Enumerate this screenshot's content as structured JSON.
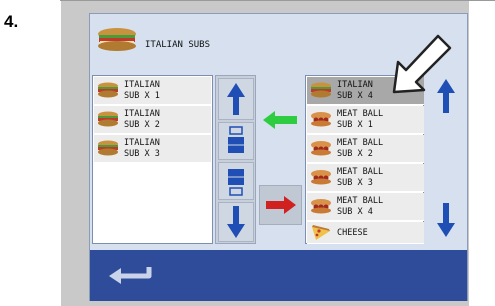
{
  "step": {
    "number": "4."
  },
  "header": {
    "title": "ITALIAN SUBS",
    "icon": "sub-sandwich-icon"
  },
  "left_list": {
    "items": [
      {
        "label": "ITALIAN\nSUB X 1",
        "icon": "sub-sandwich-icon"
      },
      {
        "label": "ITALIAN\nSUB X 2",
        "icon": "sub-sandwich-icon"
      },
      {
        "label": "ITALIAN\nSUB X 3",
        "icon": "sub-sandwich-icon"
      }
    ]
  },
  "right_list": {
    "items": [
      {
        "label": "ITALIAN\nSUB X 4",
        "icon": "sub-sandwich-icon",
        "selected": true
      },
      {
        "label": "MEAT BALL\nSUB X 1",
        "icon": "meatball-sub-icon"
      },
      {
        "label": "MEAT BALL\nSUB X 2",
        "icon": "meatball-sub-icon"
      },
      {
        "label": "MEAT BALL\nSUB X 3",
        "icon": "meatball-sub-icon"
      },
      {
        "label": "MEAT BALL\nSUB X 4",
        "icon": "meatball-sub-icon"
      },
      {
        "label": "CHEESE",
        "icon": "pizza-slice-icon"
      }
    ]
  },
  "colors": {
    "arrow_blue": "#1f4fb5",
    "transfer_left": "#2ecc40",
    "transfer_right": "#d12020",
    "bottom_bar": "#2f4c9a"
  }
}
